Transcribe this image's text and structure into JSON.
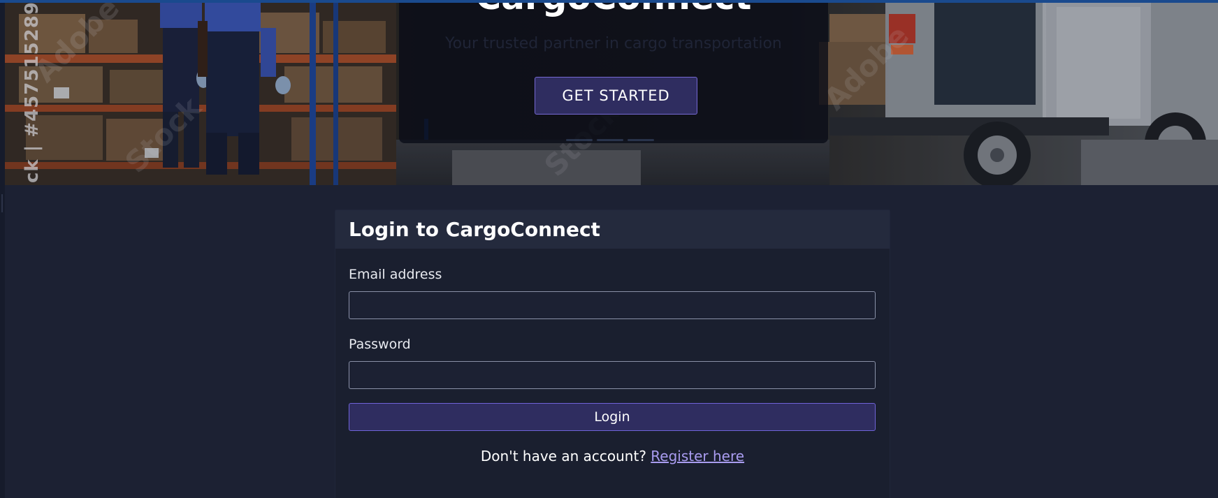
{
  "hero": {
    "watermark_id": "ck | #457515289",
    "watermark_brand": "Adobe Stock",
    "title": "CargoConnect",
    "subtitle": "Your trusted partner in cargo transportation",
    "cta_label": "GET STARTED",
    "carousel_indicator_count": 3
  },
  "login": {
    "title": "Login to CargoConnect",
    "email_label": "Email address",
    "email_value": "",
    "password_label": "Password",
    "password_value": "",
    "submit_label": "Login",
    "register_prompt": "Don't have an account?",
    "register_link": "Register here"
  },
  "colors": {
    "page_background": "#1c2133",
    "card_header": "#242a3d",
    "primary_button": "#2f2d60",
    "primary_border": "#6f63d8",
    "link": "#a99cf0",
    "top_strip": "#1a4a8e"
  }
}
